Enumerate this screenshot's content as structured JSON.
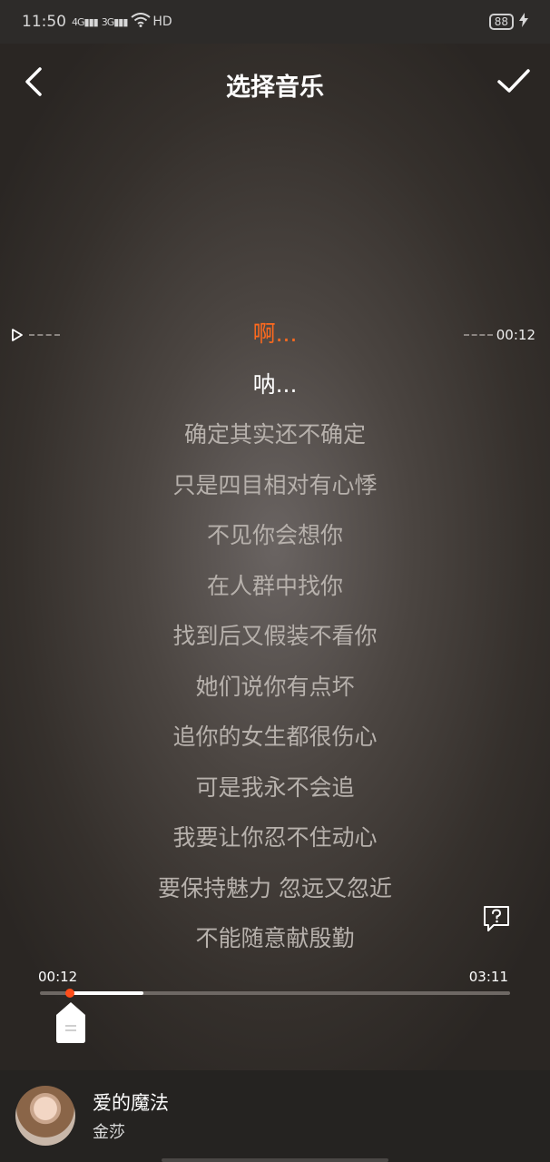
{
  "status_bar": {
    "time": "11:50",
    "signal1": "4G",
    "signal2": "3G",
    "network": "HD",
    "battery": "88"
  },
  "header": {
    "title": "选择音乐"
  },
  "markers": {
    "current_time": "00:12"
  },
  "lyrics": [
    "啊...",
    "呐...",
    "确定其实还不确定",
    "只是四目相对有心悸",
    "不见你会想你",
    "在人群中找你",
    "找到后又假装不看你",
    "她们说你有点坏",
    "追你的女生都很伤心",
    "可是我永不会追",
    "我要让你忍不住动心",
    "要保持魅力 忽远又忽近",
    "不能随意献殷勤"
  ],
  "progress": {
    "start": "00:12",
    "end": "03:11",
    "position_fraction": 0.064,
    "selection_end_fraction": 0.22
  },
  "now_playing": {
    "title": "爱的魔法",
    "artist": "金莎"
  },
  "colors": {
    "accent": "#ff6a1e",
    "background": "#3a3430",
    "lyric_dim": "#b7b1ac"
  }
}
